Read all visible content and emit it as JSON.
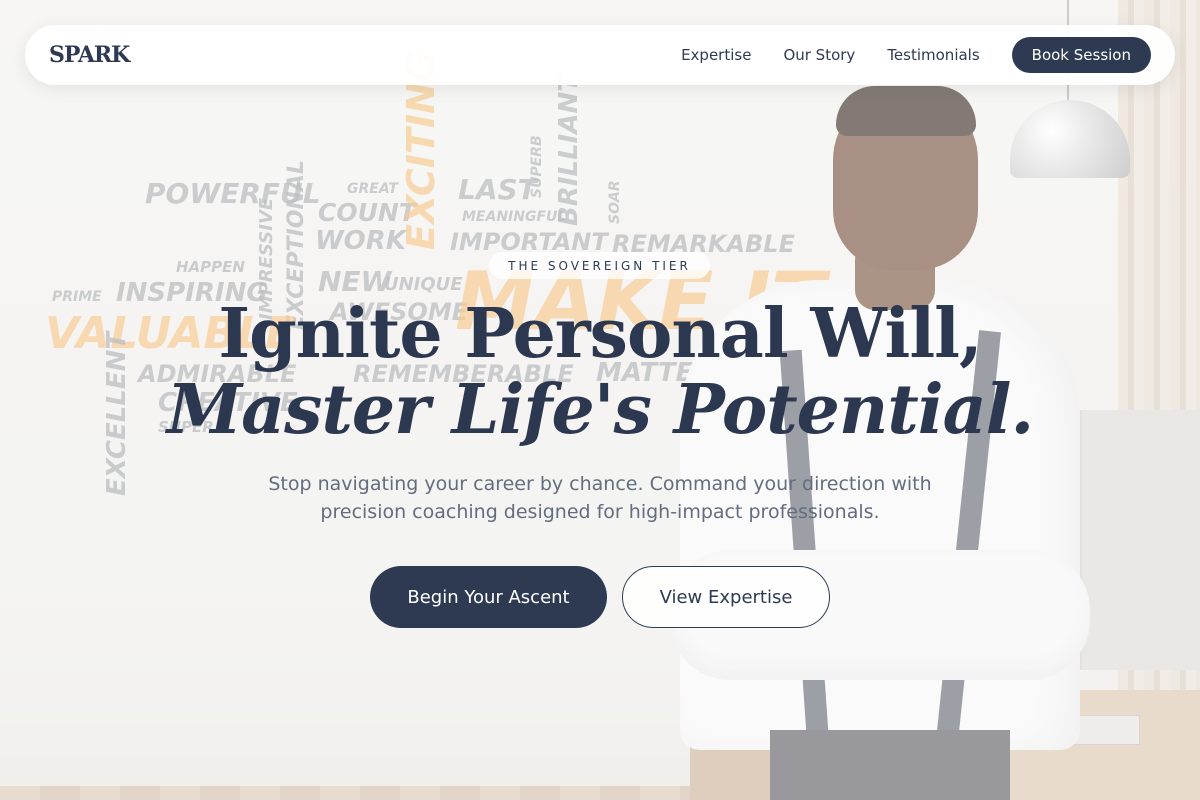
{
  "brand": {
    "name": "SPARK"
  },
  "nav": {
    "links": [
      "Expertise",
      "Our Story",
      "Testimonials"
    ],
    "cta": "Book Session"
  },
  "hero": {
    "badge": "THE SOVEREIGN TIER",
    "headline_line1": "Ignite Personal Will,",
    "headline_line2": "Master Life's Potential.",
    "subtitle": "Stop navigating your career by chance. Command your direction with precision coaching designed for high-impact professionals.",
    "primary_cta": "Begin Your Ascent",
    "secondary_cta": "View Expertise"
  },
  "background_words": {
    "w0": "POWERFUL",
    "w1": "GREAT",
    "w2": "COUNT",
    "w3": "WORK",
    "w4": "EXCITING",
    "w5": "LAST",
    "w6": "MEANINGFUL",
    "w7": "SUPERB",
    "w8": "BRILLIANT",
    "w9": "SOAR",
    "w10": "IMPORTANT",
    "w11": "REMARKABLE",
    "w12": "HAPPEN",
    "w13": "INSPIRING",
    "w14": "PRIME",
    "w15": "IMPRESSIVE",
    "w16": "EXCEPTIONAL",
    "w17": "NEW",
    "w18": "UNIQUE",
    "w19": "AWESOME",
    "w20": "VALUABLE",
    "w21": "MAKE IT",
    "w22": "ADMIRABLE",
    "w23": "CREATIVE",
    "w24": "SUPER",
    "w25": "EXCELLENT",
    "w26": "REMEMBERABLE",
    "w27": "MATTER"
  },
  "colors": {
    "primary": "#2d3a52",
    "text_muted": "#636d7e",
    "accent_orange": "#f3a847",
    "navbar_bg": "#ffffff"
  }
}
